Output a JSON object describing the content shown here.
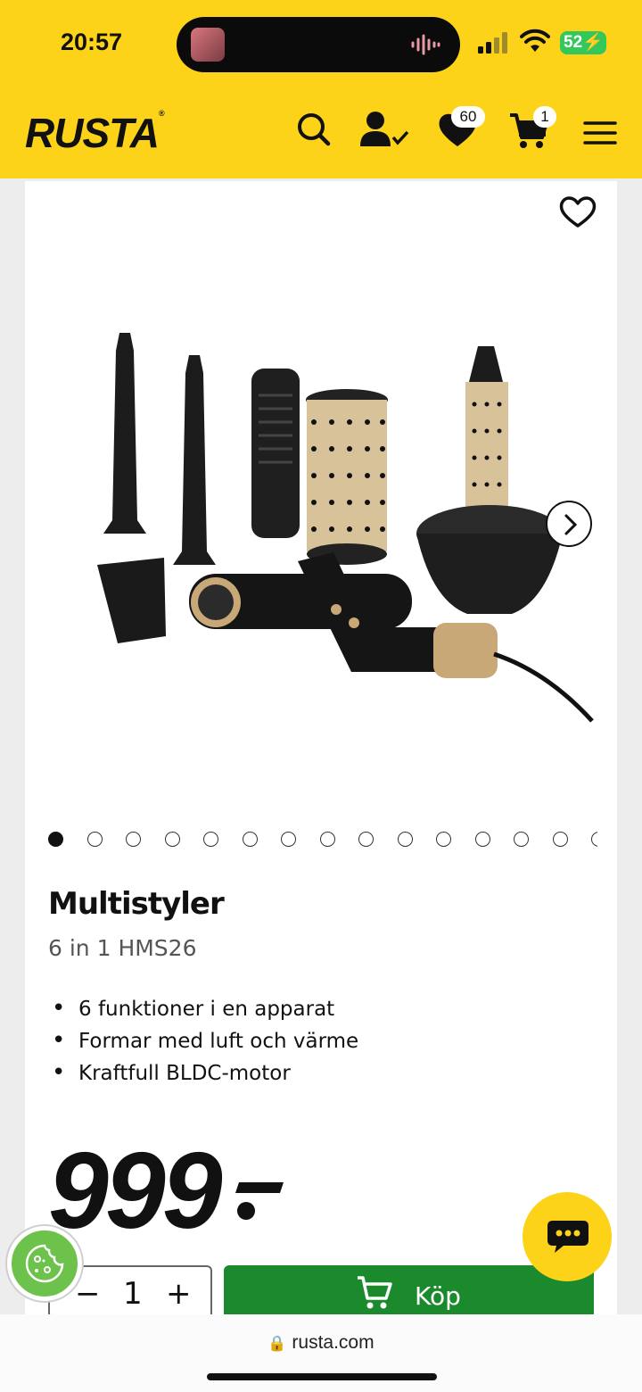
{
  "status_bar": {
    "time": "20:57",
    "battery": "52"
  },
  "header": {
    "logo": "RUSTA",
    "wishlist_count": "60",
    "cart_count": "1",
    "icons": [
      "search-icon",
      "account-icon",
      "heart-icon",
      "cart-icon",
      "menu-icon"
    ]
  },
  "product": {
    "title": "Multistyler",
    "subtitle": "6 in 1 HMS26",
    "features": [
      "6 funktioner i en apparat",
      "Formar med luft och värme",
      "Kraftfull BLDC-motor"
    ],
    "price": "999",
    "gallery_total": 15,
    "gallery_active": 1
  },
  "purchase": {
    "quantity": "1",
    "minus": "−",
    "plus": "+",
    "buy_label": "Köp"
  },
  "browser": {
    "url": "rusta.com"
  },
  "colors": {
    "brand_yellow": "#fdd319",
    "buy_green": "#1a8a2d",
    "cookie_green": "#6cc24a"
  }
}
